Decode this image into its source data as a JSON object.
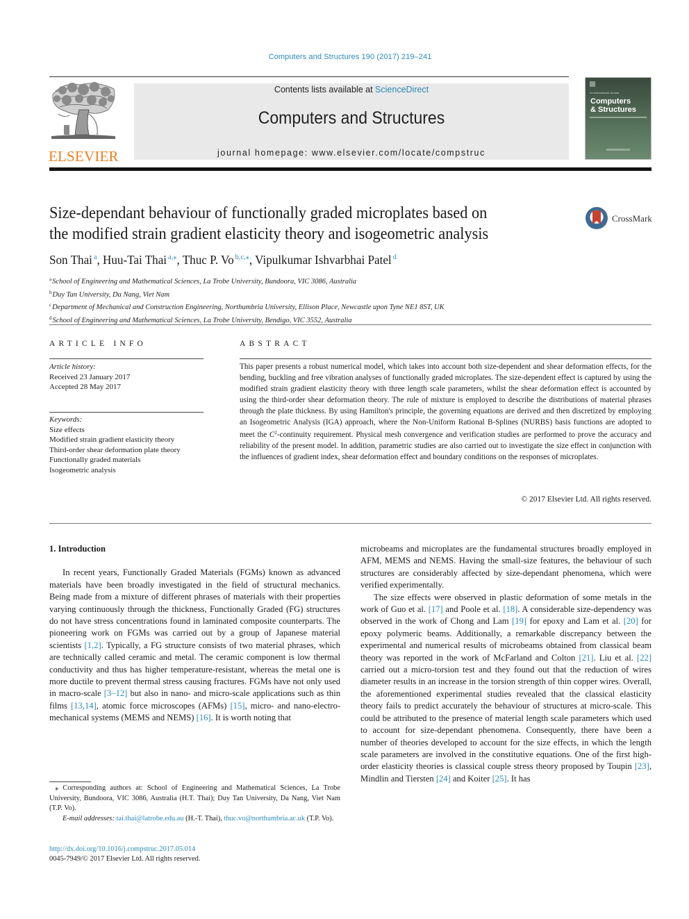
{
  "header": {
    "journal_ref": "Computers and Structures 190 (2017) 219–241",
    "contents_prefix": "Contents lists available at ",
    "contents_link": "ScienceDirect",
    "journal_name": "Computers and Structures",
    "homepage": "journal homepage: www.elsevier.com/locate/compstruc",
    "publisher_logo_text": "ELSEVIER",
    "cover": {
      "small_text": "An International Journal",
      "title_line1": "Computers",
      "title_line2": "& Structures"
    },
    "colors": {
      "link": "#2a8ab8",
      "elsevier_orange": "#f07d1a",
      "masthead_bg": "#e9e9e9"
    }
  },
  "article": {
    "title_line1": "Size-dependant behaviour of functionally graded microplates based on",
    "title_line2": "the modified strain gradient elasticity theory and isogeometric analysis",
    "crossmark_label": "CrossMark",
    "authors": [
      {
        "name": "Son Thai",
        "sup": "a",
        "sep": ", "
      },
      {
        "name": "Huu-Tai Thai",
        "sup": "a,⁎",
        "sep": ", "
      },
      {
        "name": "Thuc P. Vo",
        "sup": "b,c,⁎",
        "sep": ", "
      },
      {
        "name": "Vipulkumar Ishvarbhai Patel",
        "sup": "d",
        "sep": ""
      }
    ],
    "affiliations": [
      {
        "key": "a",
        "text": "School of Engineering and Mathematical Sciences, La Trobe University, Bundoora, VIC 3086, Australia"
      },
      {
        "key": "b",
        "text": "Duy Tan University, Da Nang, Viet Nam"
      },
      {
        "key": "c",
        "text": "Department of Mechanical and Construction Engineering, Northumbria University, Ellison Place, Newcastle upon Tyne NE1 8ST, UK"
      },
      {
        "key": "d",
        "text": "School of Engineering and Mathematical Sciences, La Trobe University, Bendigo, VIC 3552, Australia"
      }
    ]
  },
  "article_info": {
    "heading": "ARTICLE INFO",
    "history_label": "Article history:",
    "received": "Received 23 January 2017",
    "accepted": "Accepted 28 May 2017",
    "keywords_label": "Keywords:",
    "keywords": [
      "Size effects",
      "Modified strain gradient elasticity theory",
      "Third-order shear deformation plate theory",
      "Functionally graded materials",
      "Isogeometric analysis"
    ]
  },
  "abstract": {
    "heading": "ABSTRACT",
    "text_part1": "This paper presents a robust numerical model, which takes into account both size-dependent and shear deformation effects, for the bending, buckling and free vibration analyses of functionally graded microplates. The size-dependent effect is captured by using the modified strain gradient elasticity theory with three length scale parameters, whilst the shear deformation effect is accounted by using the third-order shear deformation theory. The rule of mixture is employed to describe the distributions of material phrases through the plate thickness. By using Hamilton's principle, the governing equations are derived and then discretized by employing an Isogeometric Analysis (IGA) approach, where the Non-Uniform Rational B-Splines (NURBS) basis functions are adopted to meet the ",
    "c_symbol": "C",
    "c_sup": "2",
    "text_part2": "-continuity requirement. Physical mesh convergence and verification studies are performed to prove the accuracy and reliability of the present model. In addition, parametric studies are also carried out to investigate the size effect in conjunction with the influences of gradient index, shear deformation effect and boundary conditions on the responses of microplates.",
    "copyright": "© 2017 Elsevier Ltd. All rights reserved."
  },
  "body": {
    "section_heading": "1. Introduction",
    "left_para": [
      {
        "t": "In recent years, Functionally Graded Materials (FGMs) known as advanced materials have been broadly investigated in the field of structural mechanics. Being made from a mixture of different phrases of materials with their properties varying continuously through the thickness, Functionally Graded (FG) structures do not have stress concentrations found in laminated composite counterparts. The pioneering work on FGMs was carried out by a group of Japanese material scientists "
      },
      {
        "ref": "[1,2]"
      },
      {
        "t": ". Typically, a FG structure consists of two material phrases, which are technically called ceramic and metal. The ceramic component is low thermal conductivity and thus has higher temperature-resistant, whereas the metal one is more ductile to prevent thermal stress causing fractures. FGMs have not only used in macro-scale "
      },
      {
        "ref": "[3–12]"
      },
      {
        "t": " but also in nano- and micro-scale applications such as thin films "
      },
      {
        "ref": "[13,14]"
      },
      {
        "t": ", atomic force microscopes (AFMs) "
      },
      {
        "ref": "[15]"
      },
      {
        "t": ", micro- and nano-electro-mechanical systems (MEMS and NEMS) "
      },
      {
        "ref": "[16]"
      },
      {
        "t": ". It is worth noting that"
      }
    ],
    "right_para1": "microbeams and microplates are the fundamental structures broadly employed in AFM, MEMS and NEMS. Having the small-size features, the behaviour of such structures are considerably affected by size-dependant phenomena, which were verified experimentally.",
    "right_para2": [
      {
        "t": "The size effects were observed in plastic deformation of some metals in the work of Guo et al. "
      },
      {
        "ref": "[17]"
      },
      {
        "t": " and Poole et al. "
      },
      {
        "ref": "[18]"
      },
      {
        "t": ". A considerable size-dependency was observed in the work of Chong and Lam "
      },
      {
        "ref": "[19]"
      },
      {
        "t": " for epoxy and Lam et al. "
      },
      {
        "ref": "[20]"
      },
      {
        "t": " for epoxy polymeric beams. Additionally, a remarkable discrepancy between the experimental and numerical results of microbeams obtained from classical beam theory was reported in the work of McFarland and Colton "
      },
      {
        "ref": "[21]"
      },
      {
        "t": ". Liu et al. "
      },
      {
        "ref": "[22]"
      },
      {
        "t": " carried out a micro-torsion test and they found out that the reduction of wires diameter results in an increase in the torsion strength of thin copper wires. Overall, the aforementioned experimental studies revealed that the classical elasticity theory fails to predict accurately the behaviour of structures at micro-scale. This could be attributed to the presence of material length scale parameters which used to account for size-dependant phenomena. Consequently, there have been a number of theories developed to account for the size effects, in which the length scale parameters are involved in the constitutive equations. One of the first high-order elasticity theories is classical couple stress theory proposed by Toupin "
      },
      {
        "ref": "[23]"
      },
      {
        "t": ", Mindlin and Tiersten "
      },
      {
        "ref": "[24]"
      },
      {
        "t": " and Koiter "
      },
      {
        "ref": "[25]"
      },
      {
        "t": ". It has"
      }
    ]
  },
  "footnotes": {
    "corresponding": "⁎  Corresponding authors at: School of Engineering and Mathematical Sciences, La Trobe University, Bundoora, VIC 3086, Australia (H.T. Thai); Duy Tan University, Da Nang, Viet Nam (T.P. Vo).",
    "email_label": "E-mail addresses:",
    "email1": "tai.thai@latrobe.edu.au",
    "email1_owner": " (H.-T. Thai), ",
    "email2": "thuc.vo@northumbria.ac.uk",
    "email2_owner": " (T.P. Vo).",
    "doi": "http://dx.doi.org/10.1016/j.compstruc.2017.05.014",
    "issn_copyright": "0045-7949/© 2017 Elsevier Ltd. All rights reserved."
  }
}
